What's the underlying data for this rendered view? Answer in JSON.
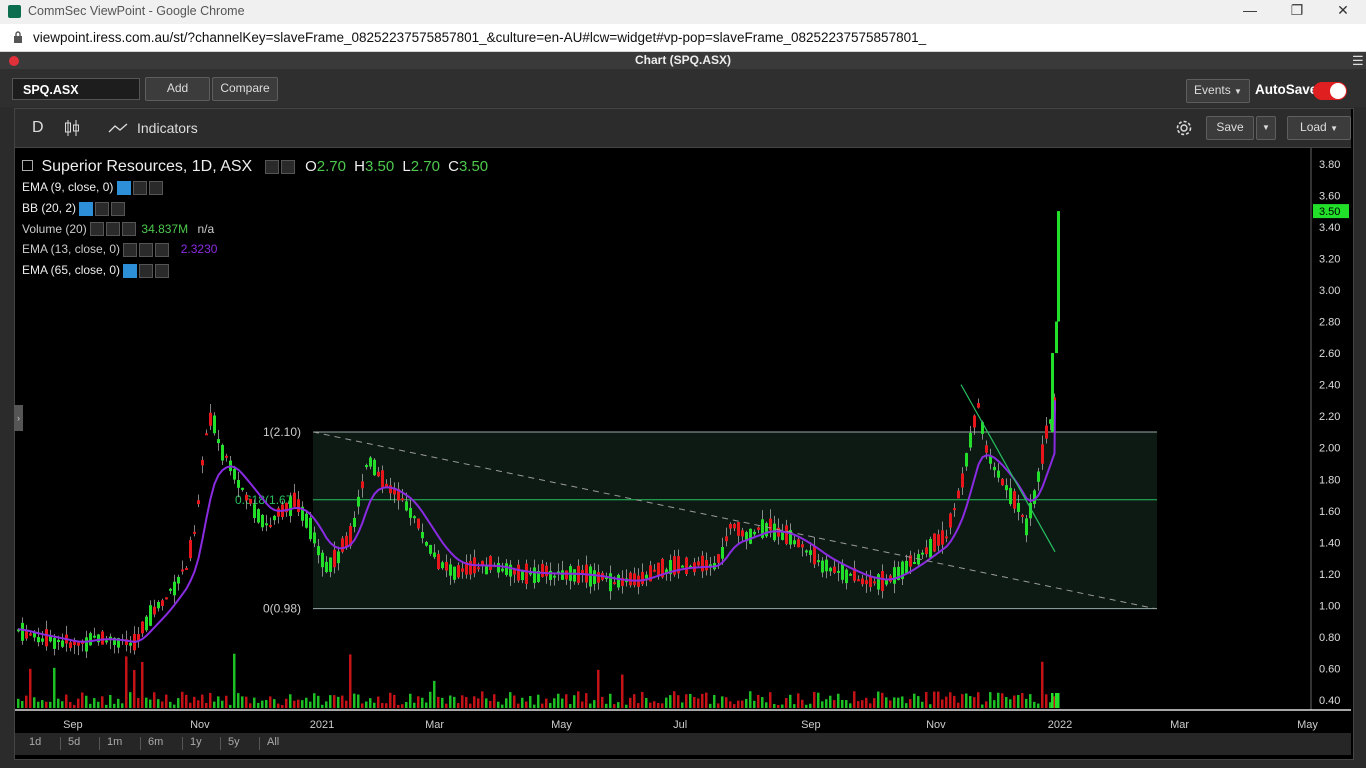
{
  "window": {
    "title": "CommSec ViewPoint - Google Chrome",
    "url": "viewpoint.iress.com.au/st/?channelKey=slaveFrame_08252237575857801_&culture=en-AU#lcw=widget#vp-pop=slaveFrame_08252237575857801_"
  },
  "panel": {
    "title": "Chart (SPQ.ASX)"
  },
  "toolbar": {
    "symbol": "SPQ.ASX",
    "add_label": "Add",
    "compare_label": "Compare",
    "events_label": "Events",
    "autosave_label": "AutoSave",
    "interval": "D",
    "indicators_label": "Indicators",
    "save_label": "Save",
    "load_label": "Load"
  },
  "legend": {
    "title": "Superior Resources, 1D, ASX",
    "ohlc": {
      "o_label": "O",
      "o": "2.70",
      "h_label": "H",
      "h": "3.50",
      "l_label": "L",
      "l": "2.70",
      "c_label": "C",
      "c": "3.50"
    },
    "indicators": [
      {
        "name": "EMA (9, close, 0)",
        "value": "",
        "value2": ""
      },
      {
        "name": "BB (20, 2)",
        "value": "",
        "value2": ""
      },
      {
        "name": "Volume (20)",
        "value": "34.837M",
        "value2": "n/a"
      },
      {
        "name": "EMA (13, close, 0)",
        "value": "2.3230",
        "value2": ""
      },
      {
        "name": "EMA (65, close, 0)",
        "value": "",
        "value2": ""
      }
    ]
  },
  "fib": {
    "level1": "1(2.10)",
    "level618": "0.618(1.67)",
    "level0": "0(0.98)"
  },
  "last_price_badge": "3.50",
  "range_buttons": [
    "1d",
    "5d",
    "1m",
    "6m",
    "1y",
    "5y",
    "All"
  ],
  "colors": {
    "up": "#22e02a",
    "down": "#e8151b",
    "ema": "#8a2be2",
    "accent_toggle": "#e02020"
  },
  "chart_data": {
    "type": "candlestick",
    "y_ticks": [
      "3.80",
      "3.60",
      "3.40",
      "3.20",
      "3.00",
      "2.80",
      "2.60",
      "2.40",
      "2.20",
      "2.00",
      "1.80",
      "1.60",
      "1.40",
      "1.20",
      "1.00",
      "0.80",
      "0.60",
      "0.40"
    ],
    "x_ticks": [
      "Sep",
      "Nov",
      "2021",
      "Mar",
      "May",
      "Jul",
      "Sep",
      "Nov",
      "2022",
      "Mar",
      "May"
    ],
    "ylim": [
      0.35,
      3.9
    ],
    "price_path": [
      [
        0,
        0.85
      ],
      [
        20,
        0.8
      ],
      [
        40,
        0.78
      ],
      [
        60,
        0.75
      ],
      [
        80,
        0.8
      ],
      [
        100,
        0.78
      ],
      [
        118,
        0.75
      ],
      [
        135,
        0.95
      ],
      [
        150,
        1.05
      ],
      [
        160,
        1.15
      ],
      [
        170,
        1.25
      ],
      [
        180,
        1.5
      ],
      [
        188,
        2.05
      ],
      [
        196,
        2.2
      ],
      [
        204,
        2.0
      ],
      [
        215,
        1.9
      ],
      [
        228,
        1.7
      ],
      [
        240,
        1.6
      ],
      [
        252,
        1.5
      ],
      [
        265,
        1.6
      ],
      [
        278,
        1.65
      ],
      [
        290,
        1.55
      ],
      [
        300,
        1.4
      ],
      [
        310,
        1.25
      ],
      [
        320,
        1.3
      ],
      [
        335,
        1.45
      ],
      [
        352,
        1.95
      ],
      [
        365,
        1.8
      ],
      [
        380,
        1.7
      ],
      [
        395,
        1.6
      ],
      [
        410,
        1.4
      ],
      [
        425,
        1.25
      ],
      [
        440,
        1.2
      ],
      [
        460,
        1.25
      ],
      [
        480,
        1.25
      ],
      [
        500,
        1.2
      ],
      [
        520,
        1.2
      ],
      [
        540,
        1.2
      ],
      [
        560,
        1.2
      ],
      [
        580,
        1.18
      ],
      [
        600,
        1.15
      ],
      [
        620,
        1.15
      ],
      [
        640,
        1.22
      ],
      [
        660,
        1.25
      ],
      [
        680,
        1.25
      ],
      [
        700,
        1.25
      ],
      [
        715,
        1.5
      ],
      [
        730,
        1.45
      ],
      [
        750,
        1.5
      ],
      [
        770,
        1.45
      ],
      [
        790,
        1.35
      ],
      [
        810,
        1.25
      ],
      [
        830,
        1.2
      ],
      [
        850,
        1.15
      ],
      [
        870,
        1.15
      ],
      [
        890,
        1.25
      ],
      [
        910,
        1.35
      ],
      [
        930,
        1.45
      ],
      [
        945,
        1.75
      ],
      [
        955,
        2.1
      ],
      [
        962,
        2.25
      ],
      [
        970,
        2.0
      ],
      [
        980,
        1.85
      ],
      [
        990,
        1.75
      ],
      [
        1000,
        1.65
      ],
      [
        1010,
        1.5
      ],
      [
        1020,
        1.75
      ],
      [
        1030,
        2.1
      ],
      [
        1038,
        2.25
      ],
      [
        1045,
        2.2
      ],
      [
        1050,
        2.1
      ],
      [
        1053,
        2.6
      ],
      [
        1055,
        3.5
      ]
    ]
  }
}
